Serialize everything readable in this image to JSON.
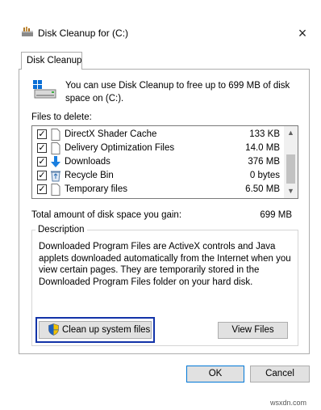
{
  "window": {
    "title": "Disk Cleanup for  (C:)",
    "close_label": "×"
  },
  "tab": {
    "label": "Disk Cleanup"
  },
  "intro": {
    "text": "You can use Disk Cleanup to free up to 699 MB of disk space on  (C:)."
  },
  "files_to_delete_label": "Files to delete:",
  "files": [
    {
      "name": "DirectX Shader Cache",
      "size": "133 KB",
      "checked": true,
      "icon": "file-icon"
    },
    {
      "name": "Delivery Optimization Files",
      "size": "14.0 MB",
      "checked": true,
      "icon": "file-icon"
    },
    {
      "name": "Downloads",
      "size": "376 MB",
      "checked": true,
      "icon": "download-arrow-icon"
    },
    {
      "name": "Recycle Bin",
      "size": "0 bytes",
      "checked": true,
      "icon": "recycle-bin-icon"
    },
    {
      "name": "Temporary files",
      "size": "6.50 MB",
      "checked": true,
      "icon": "file-icon"
    }
  ],
  "check_mark": "✓",
  "scroll": {
    "up": "▲",
    "down": "▼"
  },
  "total": {
    "label": "Total amount of disk space you gain:",
    "value": "699 MB"
  },
  "description": {
    "legend": "Description",
    "text": "Downloaded Program Files are ActiveX controls and Java applets downloaded automatically from the Internet when you view certain pages. They are temporarily stored in the Downloaded Program Files folder on your hard disk."
  },
  "buttons": {
    "cleanup_system_files": "Clean up system files",
    "view_files": "View Files",
    "ok": "OK",
    "cancel": "Cancel"
  },
  "watermark": "wsxdn.com",
  "colors": {
    "highlight_outline": "#1233a8",
    "default_button_border": "#0078d7"
  }
}
